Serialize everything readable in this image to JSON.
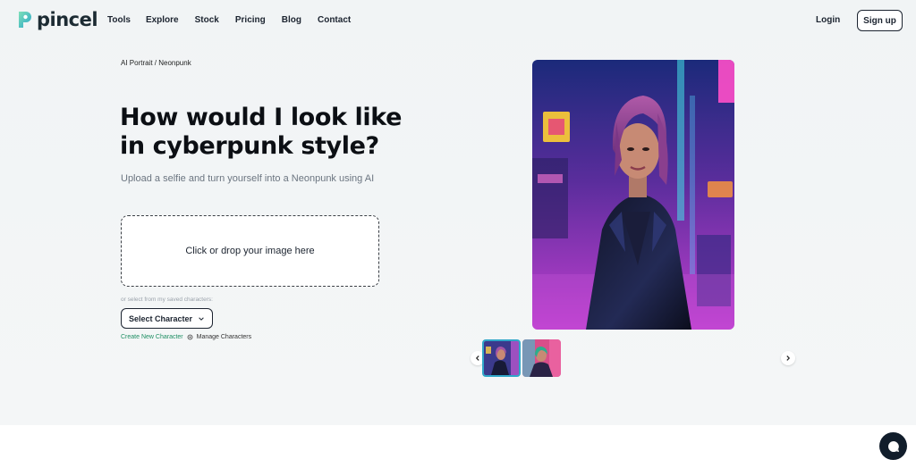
{
  "nav": {
    "logo_text": "pincel",
    "links": [
      "Tools",
      "Explore",
      "Stock",
      "Pricing",
      "Blog",
      "Contact"
    ],
    "login": "Login",
    "signup": "Sign up"
  },
  "hero": {
    "breadcrumb": "AI Portrait / Neonpunk",
    "title": "How would I look like in cyberpunk style?",
    "subtitle": "Upload a selfie and turn yourself into a Neonpunk using AI",
    "dropzone_label": "Click or drop your image here",
    "saved_hint": "or select from my saved characters:",
    "select_character": "Select Character",
    "create_link": "Create New Character",
    "manage_link": "Manage Characters"
  },
  "gallery": {
    "main_image": "cyberpunk-woman-portrait",
    "thumbnails": [
      "cyberpunk-woman-thumb",
      "neon-woman-thumb"
    ],
    "active_index": 0
  },
  "colors": {
    "accent_green": "#1f8f63",
    "thumb_border": "#2fa7c9",
    "chat_bg": "#111d2b"
  },
  "icons": {
    "prev": "chevron-left-icon",
    "next": "chevron-right-icon",
    "chat": "chat-bubble-icon",
    "manage": "gear-icon",
    "select": "chevron-down-icon"
  }
}
